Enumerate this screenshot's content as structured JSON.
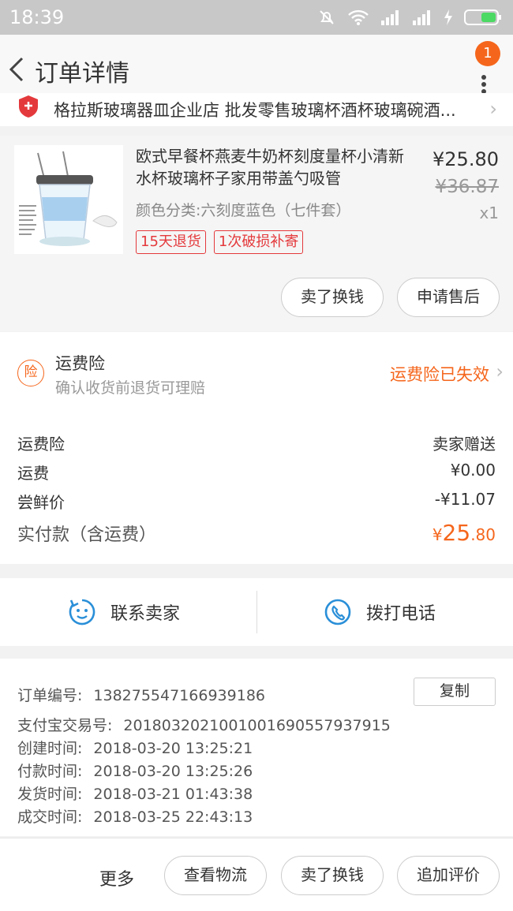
{
  "status_bar": {
    "time": "18:39"
  },
  "nav": {
    "title": "订单详情",
    "badge_count": "1"
  },
  "shop": {
    "name": "格拉斯玻璃器皿企业店 批发零售玻璃杯酒杯玻璃碗酒..."
  },
  "product": {
    "title": "欧式早餐杯燕麦牛奶杯刻度量杯小清新水杯玻璃杯子家用带盖勺吸管",
    "sku": "颜色分类:六刻度蓝色（七件套）",
    "price": "¥25.80",
    "original_price": "¥36.87",
    "quantity": "x1",
    "tags": [
      "15天退货",
      "1次破损补寄"
    ],
    "sell_label": "卖了换钱",
    "after_sale_label": "申请售后"
  },
  "insurance": {
    "icon_text": "险",
    "title": "运费险",
    "subtitle": "确认收货前退货可理赔",
    "status": "运费险已失效"
  },
  "fees": [
    {
      "label": "运费险",
      "value": "卖家赠送"
    },
    {
      "label": "运费",
      "value": "¥0.00"
    },
    {
      "label": "尝鲜价",
      "value": "-¥11.07"
    }
  ],
  "total": {
    "label": "实付款（含运费）",
    "currency": "¥",
    "integer": "25",
    "decimal": ".80"
  },
  "contact": {
    "seller_label": "联系卖家",
    "call_label": "拨打电话"
  },
  "order_info": {
    "copy_label": "复制",
    "rows": [
      {
        "label": "订单编号:",
        "value": "138275547166939186"
      },
      {
        "label": "支付宝交易号:",
        "value": "2018032021001001690557937915"
      },
      {
        "label": "创建时间:",
        "value": "2018-03-20 13:25:21"
      },
      {
        "label": "付款时间:",
        "value": "2018-03-20 13:25:26"
      },
      {
        "label": "发货时间:",
        "value": "2018-03-21 01:43:38"
      },
      {
        "label": "成交时间:",
        "value": "2018-03-25 22:43:13"
      }
    ]
  },
  "bottom_bar": {
    "more_label": "更多",
    "logistics_label": "查看物流",
    "sell_label": "卖了换钱",
    "review_label": "追加评价"
  },
  "colors": {
    "accent": "#f5661c",
    "tag_red": "#e4393c",
    "blue_icon": "#2a8fd8"
  }
}
